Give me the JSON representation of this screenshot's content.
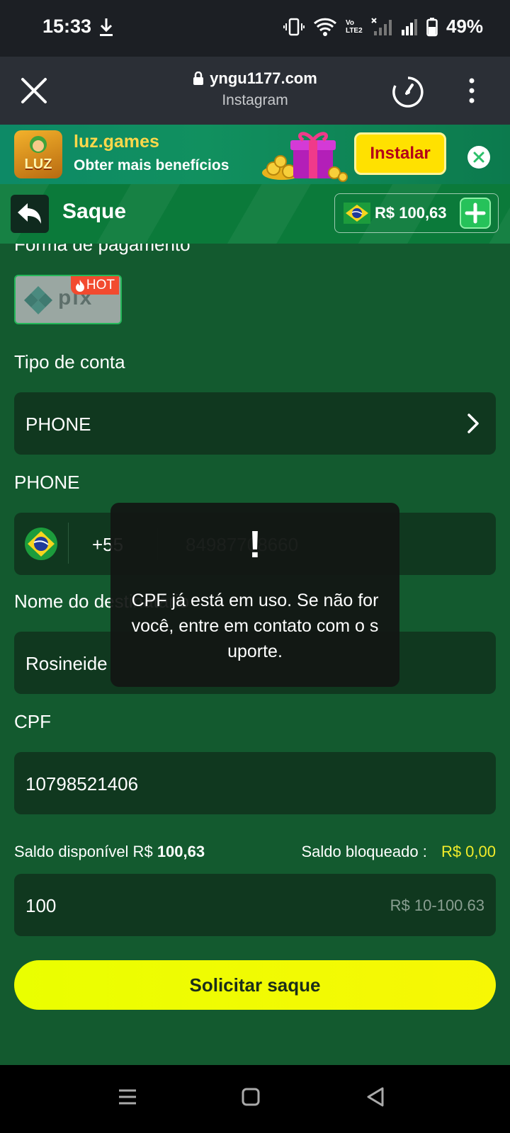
{
  "status_bar": {
    "time": "15:33",
    "battery_percent": "49%",
    "volte_label": "Vo LTE2"
  },
  "browser": {
    "url": "yngu1177.com",
    "source": "Instagram"
  },
  "ad_banner": {
    "brand": "luz.games",
    "logo_text": "LUZ",
    "tagline": "Obter mais benefícios",
    "install_label": "Instalar"
  },
  "header": {
    "title": "Saque",
    "balance": "R$ 100,63"
  },
  "form": {
    "payment_label": "Forma de pagamento",
    "pix_label": "pix",
    "hot_badge": "HOT",
    "account_type_label": "Tipo de conta",
    "account_type_value": "PHONE",
    "phone_label": "PHONE",
    "phone_code": "+55",
    "phone_number": "84987708660",
    "recipient_label": "Nome do destinatário",
    "recipient_value": "Rosineide",
    "cpf_label": "CPF",
    "cpf_value": "10798521406",
    "available_label": "Saldo disponível R$",
    "available_value": "100,63",
    "blocked_label": "Saldo bloqueado :",
    "blocked_value": "R$ 0,00",
    "amount_value": "100",
    "amount_range": "R$ 10-100.63",
    "submit_label": "Solicitar saque"
  },
  "toast": {
    "icon": "!",
    "message": "CPF já está em uso. Se não for você, entre em contato com o suporte."
  },
  "colors": {
    "page_bg": "#135a2f",
    "field_bg": "#10381f",
    "header_bg": "#0b7a3a",
    "submit_yellow": "#eaff00",
    "blocked_yellow": "#f2ec2a"
  }
}
